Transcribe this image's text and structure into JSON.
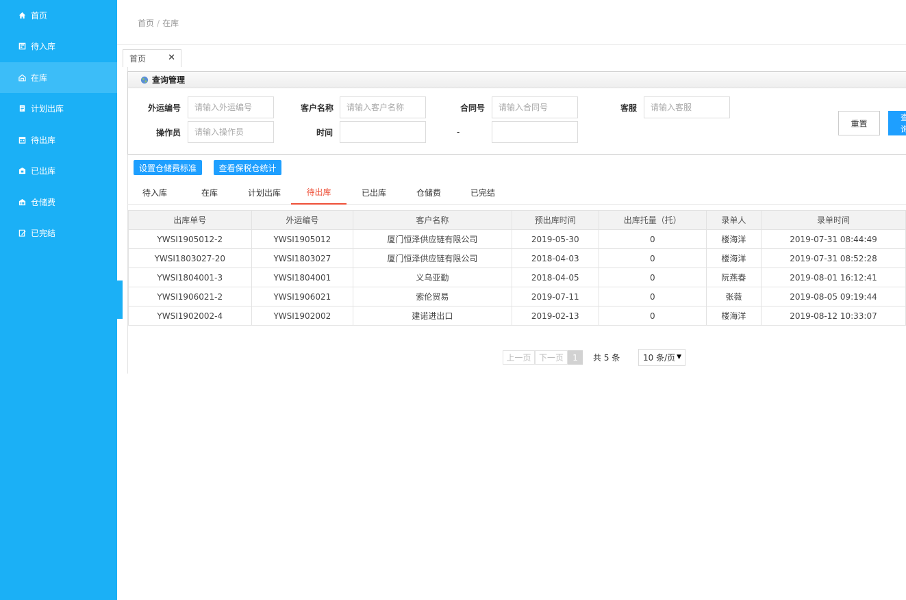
{
  "sidebar": {
    "items": [
      {
        "label": "首页",
        "icon": "home-icon"
      },
      {
        "label": "待入库",
        "icon": "inbox-icon"
      },
      {
        "label": "在库",
        "icon": "warehouse-icon"
      },
      {
        "label": "计划出库",
        "icon": "document-icon"
      },
      {
        "label": "待出库",
        "icon": "calendar-icon"
      },
      {
        "label": "已出库",
        "icon": "box-out-icon"
      },
      {
        "label": "仓储费",
        "icon": "building-icon"
      },
      {
        "label": "已完结",
        "icon": "edit-icon"
      }
    ],
    "active_index": 2,
    "color": "#1bb0f6"
  },
  "breadcrumb": {
    "home": "首页",
    "sep": "/",
    "current": "在库"
  },
  "page_tab": {
    "label": "首页",
    "close": "✕"
  },
  "query": {
    "title": "查询管理",
    "fields": {
      "waiyun": {
        "label": "外运编号",
        "placeholder": "请输入外运编号"
      },
      "customer": {
        "label": "客户名称",
        "placeholder": "请输入客户名称"
      },
      "contract": {
        "label": "合同号",
        "placeholder": "请输入合同号"
      },
      "service": {
        "label": "客服",
        "placeholder": "请输入客服"
      },
      "operator": {
        "label": "操作员",
        "placeholder": "请输入操作员"
      },
      "time": {
        "label": "时间",
        "placeholder": ""
      }
    },
    "dash": "-",
    "reset_label": "重置",
    "query_label": "查询"
  },
  "actions": {
    "set_standard": "设置仓储费标准",
    "view_stats": "查看保税仓统计"
  },
  "status_tabs": [
    "待入库",
    "在库",
    "计划出库",
    "待出库",
    "已出库",
    "仓储费",
    "已完结"
  ],
  "status_active_index": 3,
  "accent_color": "#ee4f37",
  "table": {
    "columns": [
      "出库单号",
      "外运编号",
      "客户名称",
      "预出库时间",
      "出库托量（托）",
      "录单人",
      "录单时间"
    ],
    "rows": [
      [
        "YWSI1905012-2",
        "YWSI1905012",
        "厦门恒泽供应链有限公司",
        "2019-05-30",
        "0",
        "楼海洋",
        "2019-07-31 08:44:49"
      ],
      [
        "YWSI1803027-20",
        "YWSI1803027",
        "厦门恒泽供应链有限公司",
        "2018-04-03",
        "0",
        "楼海洋",
        "2019-07-31 08:52:28"
      ],
      [
        "YWSI1804001-3",
        "YWSI1804001",
        "义乌亚勤",
        "2018-04-05",
        "0",
        "阮燕春",
        "2019-08-01 16:12:41"
      ],
      [
        "YWSI1906021-2",
        "YWSI1906021",
        "索伦贸易",
        "2019-07-11",
        "0",
        "张薇",
        "2019-08-05 09:19:44"
      ],
      [
        "YWSI1902002-4",
        "YWSI1902002",
        "建诺进出口",
        "2019-02-13",
        "0",
        "楼海洋",
        "2019-08-12 10:33:07"
      ]
    ]
  },
  "pager": {
    "prev": "上一页",
    "next": "下一页",
    "current": "1",
    "total": "共 5 条",
    "page_size": "10 条/页"
  }
}
